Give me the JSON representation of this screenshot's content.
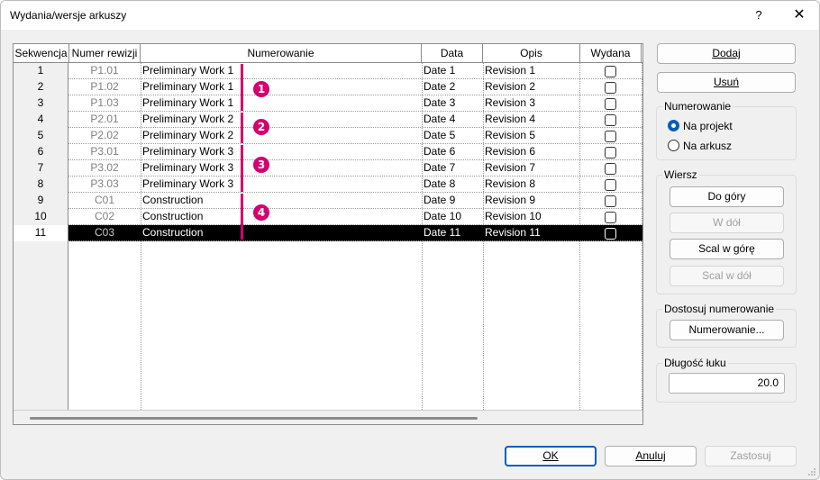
{
  "window": {
    "title": "Wydania/wersje arkuszy",
    "help_label": "?",
    "close_label": "✕"
  },
  "table": {
    "columns": [
      "Sekwencja",
      "Numer rewizji",
      "Numerowanie",
      "Data",
      "Opis",
      "Wydana"
    ],
    "rows": [
      {
        "seq": "1",
        "rev": "P1.01",
        "num": "Preliminary Work 1",
        "date": "Date 1",
        "desc": "Revision 1",
        "issued": false
      },
      {
        "seq": "2",
        "rev": "P1.02",
        "num": "Preliminary Work 1",
        "date": "Date 2",
        "desc": "Revision 2",
        "issued": false
      },
      {
        "seq": "3",
        "rev": "P1.03",
        "num": "Preliminary Work 1",
        "date": "Date 3",
        "desc": "Revision 3",
        "issued": false
      },
      {
        "seq": "4",
        "rev": "P2.01",
        "num": "Preliminary Work 2",
        "date": "Date 4",
        "desc": "Revision 4",
        "issued": false
      },
      {
        "seq": "5",
        "rev": "P2.02",
        "num": "Preliminary Work 2",
        "date": "Date 5",
        "desc": "Revision 5",
        "issued": false
      },
      {
        "seq": "6",
        "rev": "P3.01",
        "num": "Preliminary Work 3",
        "date": "Date 6",
        "desc": "Revision 6",
        "issued": false
      },
      {
        "seq": "7",
        "rev": "P3.02",
        "num": "Preliminary Work 3",
        "date": "Date 7",
        "desc": "Revision 7",
        "issued": false
      },
      {
        "seq": "8",
        "rev": "P3.03",
        "num": "Preliminary Work 3",
        "date": "Date 8",
        "desc": "Revision 8",
        "issued": false
      },
      {
        "seq": "9",
        "rev": "C01",
        "num": "Construction",
        "date": "Date 9",
        "desc": "Revision 9",
        "issued": false
      },
      {
        "seq": "10",
        "rev": "C02",
        "num": "Construction",
        "date": "Date 10",
        "desc": "Revision 10",
        "issued": false
      },
      {
        "seq": "11",
        "rev": "C03",
        "num": "Construction",
        "date": "Date 11",
        "desc": "Revision 11",
        "issued": false,
        "selected": true
      }
    ],
    "markers": [
      "1",
      "2",
      "3",
      "4"
    ],
    "marker_color": "#d4006e"
  },
  "actions": {
    "add": "Dodaj",
    "delete": "Usuń"
  },
  "numbering": {
    "title": "Numerowanie",
    "options": [
      "Na projekt",
      "Na arkusz"
    ],
    "selected": "Na projekt"
  },
  "row_group": {
    "title": "Wiersz",
    "move_up": "Do góry",
    "move_down": "W dół",
    "merge_up": "Scal w górę",
    "merge_down": "Scal w dół",
    "disabled": [
      "W dół",
      "Scal w dół"
    ]
  },
  "customize": {
    "title": "Dostosuj numerowanie",
    "button": "Numerowanie..."
  },
  "arc_length": {
    "title": "Długość łuku",
    "value": "20.0"
  },
  "footer": {
    "ok": "OK",
    "cancel": "Anuluj",
    "apply": "Zastosuj"
  },
  "colors": {
    "accent": "#005fb8",
    "selection_bg": "#000000"
  }
}
